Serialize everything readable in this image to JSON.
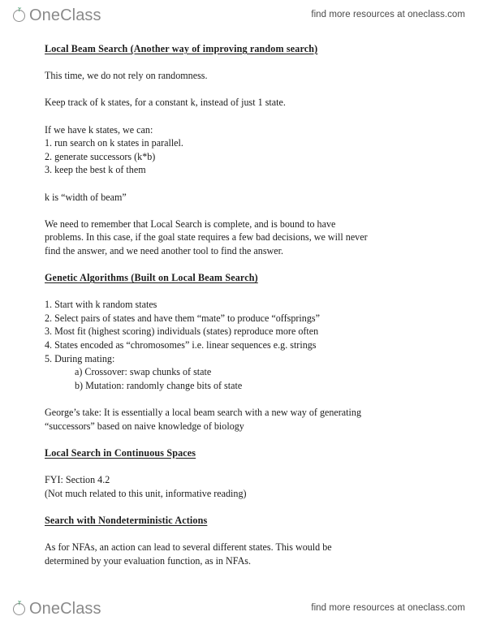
{
  "watermark": {
    "brand_name": "OneClass",
    "tagline": "find more resources at oneclass.com",
    "brand_color": "#8a8a8a",
    "leaf_color": "#2e8b57"
  },
  "document": {
    "sections": [
      {
        "heading": "Local Beam Search (Another way of improving random search)",
        "blocks": [
          {
            "type": "paragraph",
            "lines": [
              "This time, we do not rely on randomness."
            ]
          },
          {
            "type": "paragraph",
            "lines": [
              "Keep track of k states, for a constant k, instead of just 1 state."
            ]
          },
          {
            "type": "paragraph",
            "lines": [
              "If we have k states, we can:",
              "1. run search on k states in parallel.",
              "2. generate successors (k*b)",
              "3. keep the best k of them"
            ]
          },
          {
            "type": "paragraph",
            "lines": [
              "k is “width of beam”"
            ]
          },
          {
            "type": "paragraph",
            "lines": [
              "We need to remember that Local Search is complete, and is bound to have",
              "problems. In this case, if the goal state requires a few bad decisions, we will never",
              "find the answer, and we need another tool to find the answer."
            ]
          }
        ]
      },
      {
        "heading": "Genetic Algorithms (Built on Local Beam Search)",
        "blocks": [
          {
            "type": "paragraph",
            "lines": [
              "1. Start with k random states",
              "2. Select pairs of states and have them “mate” to produce “offsprings”",
              "3. Most fit (highest scoring) individuals (states) reproduce more often",
              "4. States encoded as “chromosomes” i.e. linear sequences e.g. strings",
              "5. During mating:"
            ]
          },
          {
            "type": "sublist",
            "lines": [
              "a) Crossover: swap chunks of state",
              "b) Mutation: randomly change bits of state"
            ]
          },
          {
            "type": "paragraph",
            "lines": [
              "George’s take: It is essentially a local beam search with a new way of generating",
              "“successors” based on naive knowledge of biology"
            ]
          }
        ]
      },
      {
        "heading": "Local Search in Continuous Spaces",
        "blocks": [
          {
            "type": "paragraph",
            "lines": [
              "FYI: Section 4.2",
              "(Not much related to this unit, informative reading)"
            ]
          }
        ]
      },
      {
        "heading": "Search with Nondeterministic Actions",
        "blocks": [
          {
            "type": "paragraph",
            "lines": [
              "As for NFAs, an action can lead to several different states. This would be",
              "determined by your evaluation function, as in NFAs."
            ]
          }
        ]
      }
    ]
  }
}
